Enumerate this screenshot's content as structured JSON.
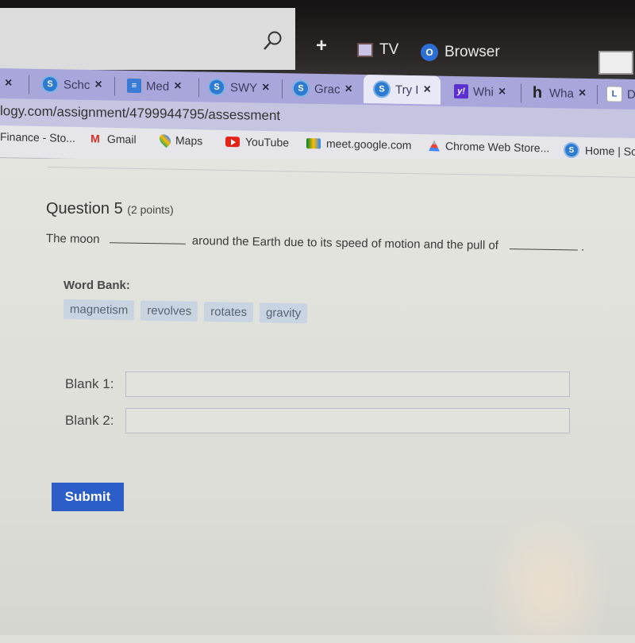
{
  "taskbar": {
    "plus_label": "+",
    "tv_label": "TV",
    "browser_label": "Browser",
    "browser_icon_letter": "O"
  },
  "tabs": [
    {
      "label": "",
      "icon": "unknown",
      "active": false
    },
    {
      "label": "Schc",
      "icon": "schoology-icon",
      "active": false
    },
    {
      "label": "Med",
      "icon": "docs-icon",
      "active": false
    },
    {
      "label": "SWY",
      "icon": "schoology-icon",
      "active": false
    },
    {
      "label": "Grac",
      "icon": "schoology-icon",
      "active": false
    },
    {
      "label": "Try I",
      "icon": "schoology-icon",
      "active": true
    },
    {
      "label": "Whi",
      "icon": "yahoo-icon",
      "active": false
    },
    {
      "label": "Wha",
      "icon": "homework-icon",
      "active": false
    },
    {
      "label": "D",
      "icon": "l-icon",
      "active": false
    }
  ],
  "tab_close_glyph": "×",
  "address": {
    "url": "logy.com/assignment/4799944795/assessment"
  },
  "bookmarks": [
    {
      "label": "Finance - Sto...",
      "icon": "none"
    },
    {
      "label": "Gmail",
      "icon": "gmail-icon"
    },
    {
      "label": "Maps",
      "icon": "maps-icon"
    },
    {
      "label": "YouTube",
      "icon": "youtube-icon"
    },
    {
      "label": "meet.google.com",
      "icon": "meet-icon"
    },
    {
      "label": "Chrome Web Store...",
      "icon": "chrome-web-store-icon"
    },
    {
      "label": "Home | Sch",
      "icon": "schoology-icon"
    }
  ],
  "question": {
    "title": "Question 5",
    "points": "(2 points)",
    "text_part1": "The moon",
    "text_part2": "around the Earth due to its speed of motion and the pull of",
    "text_end": ".",
    "word_bank_label": "Word Bank:",
    "word_bank": [
      "magnetism",
      "revolves",
      "rotates",
      "gravity"
    ],
    "blanks": [
      {
        "label": "Blank 1:",
        "value": ""
      },
      {
        "label": "Blank 2:",
        "value": ""
      }
    ],
    "submit_label": "Submit"
  }
}
